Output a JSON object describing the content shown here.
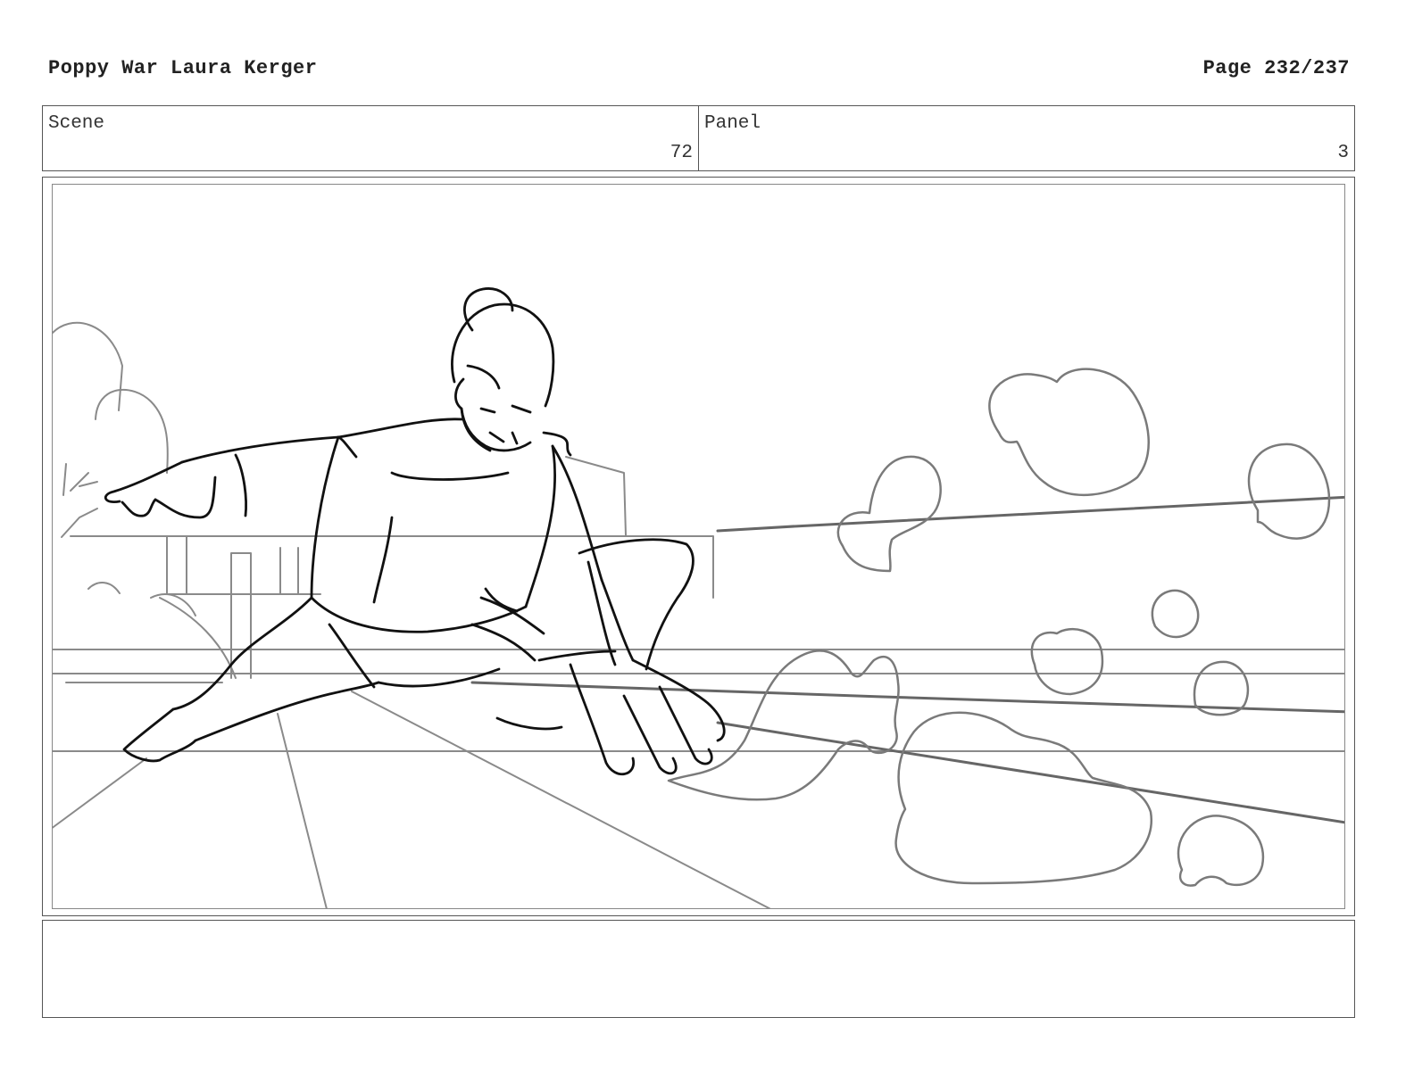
{
  "header": {
    "title": "Poppy War  Laura Kerger",
    "page": "Page 232/237"
  },
  "info": {
    "scene_label": "Scene",
    "scene_value": "72",
    "panel_label": "Panel",
    "panel_value": "3"
  },
  "notes": {
    "text": ""
  },
  "colors": {
    "line": "#111111",
    "sketch": "#777777",
    "border": "#555555"
  }
}
